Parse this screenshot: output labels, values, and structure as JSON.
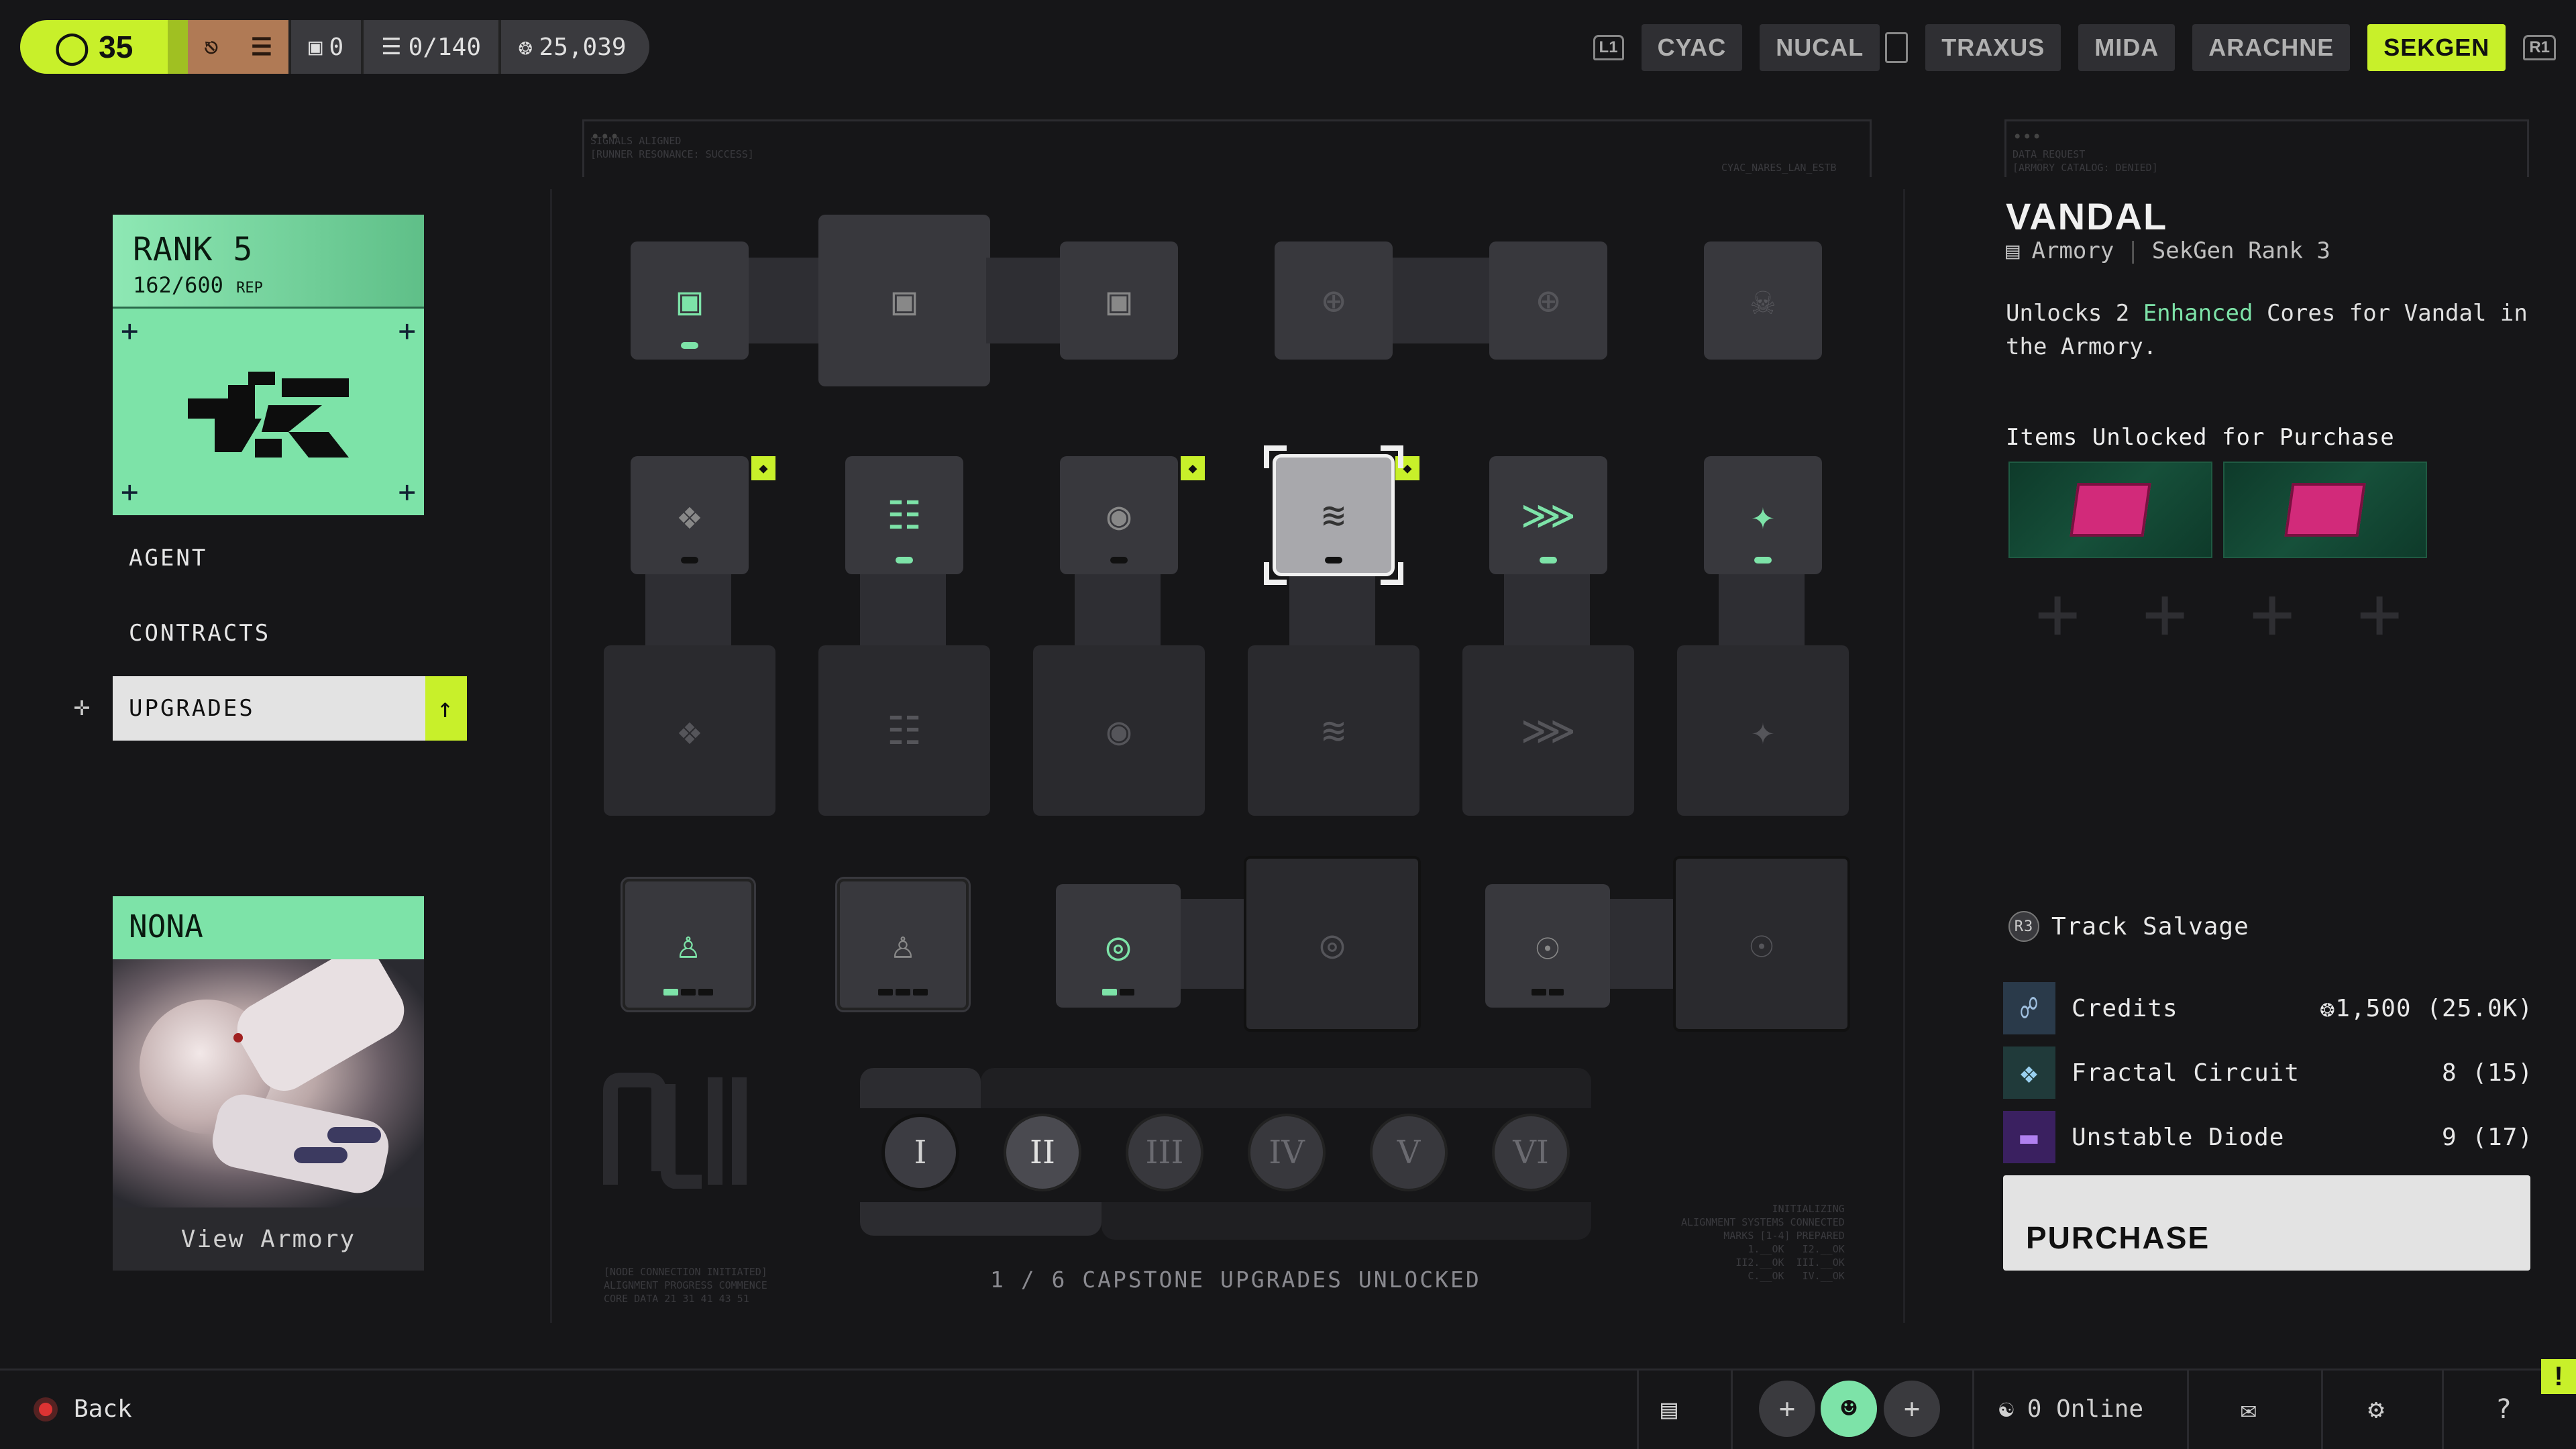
{
  "status": {
    "level": "35",
    "storage": "0",
    "capacity": "0/140",
    "currency": "25,039"
  },
  "factions": {
    "left_bumper": "L1",
    "right_bumper": "R1",
    "tabs": [
      "CYAC",
      "NUCAL",
      "TRAXUS",
      "MIDA",
      "ARACHNE",
      "SEKGEN"
    ],
    "active": "SEKGEN"
  },
  "rank": {
    "title": "RANK 5",
    "rep_value": "162/600",
    "rep_unit": "REP"
  },
  "nav": {
    "agent": "AGENT",
    "contracts": "CONTRACTS",
    "upgrades": "UPGRADES"
  },
  "agent": {
    "name": "NONA",
    "button": "View Armory"
  },
  "terminal": {
    "top_left": "SIGNALS ALIGNED\n[RUNNER RESONANCE: SUCCESS]",
    "top_right": "CYAC_NARES_LAN_ESTB",
    "right_top_left": "DATA_REQUEST\n[ARMORY CATALOG: DENIED]",
    "bottom_left": "[NODE CONNECTION INITIATED]\nALIGNMENT PROGRESS COMMENCE\nCORE DATA 21 31 41 43 51",
    "bottom_right": "INITIALIZING\nALIGNMENT SYSTEMS CONNECTED\nMARKS [1-4] PREPARED\n1.__OK   I2.__OK\nII2.__OK  III.__OK\nC.__OK   IV.__OK"
  },
  "capstone": {
    "numerals": [
      "I",
      "II",
      "III",
      "IV",
      "V",
      "VI"
    ],
    "unlocked_count": 1,
    "status_text": "1 / 6 CAPSTONE UPGRADES UNLOCKED"
  },
  "detail": {
    "title": "VANDAL",
    "category": "Armory",
    "requirement": "SekGen Rank 3",
    "desc_pre": "Unlocks 2 ",
    "desc_highlight": "Enhanced",
    "desc_post": " Cores for Vandal in the Armory.",
    "items_title": "Items Unlocked for Purchase",
    "salvage_button": "R3",
    "salvage_label": "Track Salvage",
    "costs": [
      {
        "name": "Credits",
        "value": "1,500 (25.0K)",
        "icon": "credits-icon"
      },
      {
        "name": "Fractal Circuit",
        "value": "8 (15)",
        "icon": "fractal-circuit-icon"
      },
      {
        "name": "Unstable Diode",
        "value": "9 (17)",
        "icon": "unstable-diode-icon"
      }
    ],
    "purchase_label": "PURCHASE"
  },
  "footer": {
    "back": "Back",
    "online": "0 Online",
    "alert": "!"
  },
  "colors": {
    "accent": "#c8f02a",
    "mint": "#7de3a8",
    "background": "#161618",
    "node": "#38383d",
    "item_magenta": "#d22a7a"
  }
}
